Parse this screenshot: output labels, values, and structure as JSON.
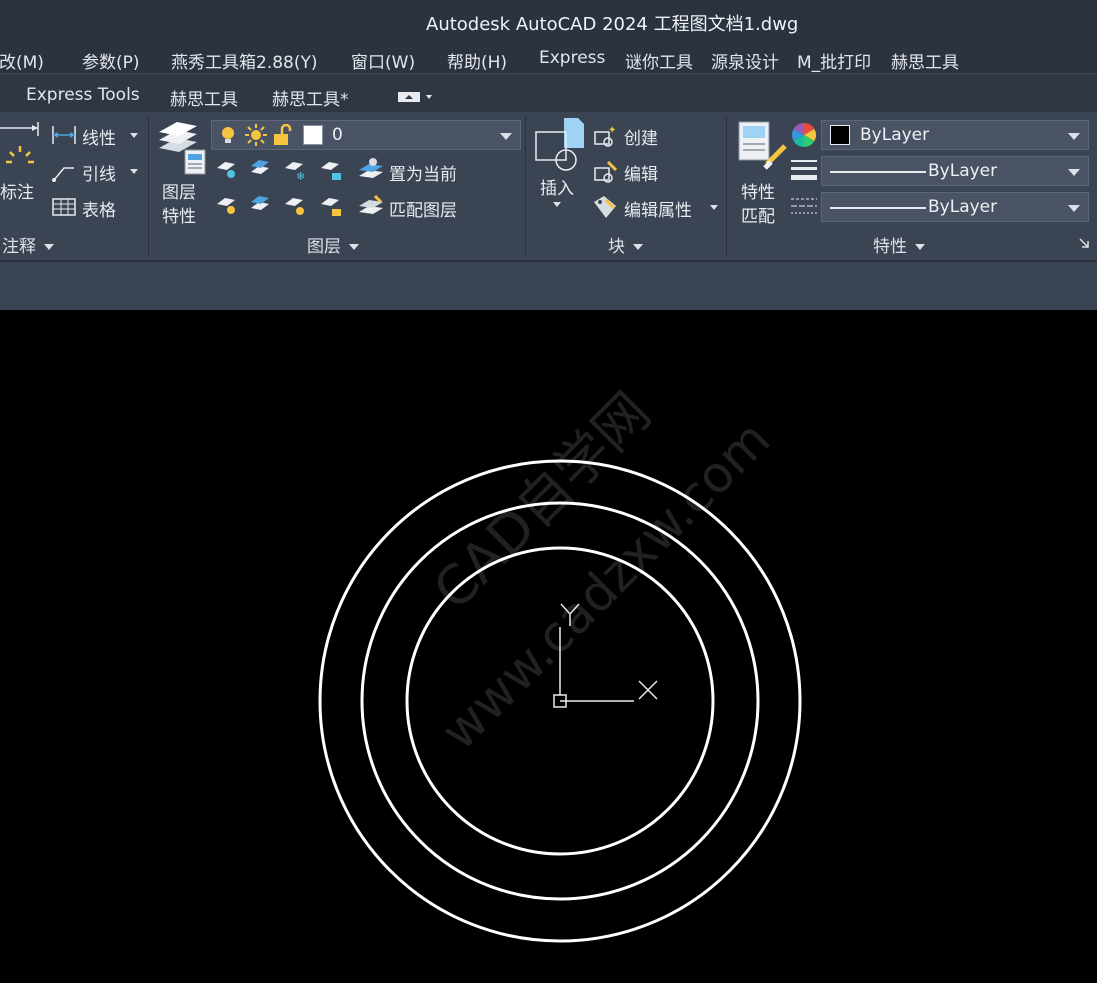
{
  "window": {
    "title": "Autodesk AutoCAD 2024    工程图文档1.dwg"
  },
  "menubar": {
    "items": [
      "修改(M)",
      "参数(P)",
      "燕秀工具箱2.88(Y)",
      "窗口(W)",
      "帮助(H)",
      "Express",
      "谜你工具",
      "源泉设计",
      "M_批打印",
      "赫思工具"
    ]
  },
  "tabs": {
    "items": [
      "Express Tools",
      "赫思工具",
      "赫思工具*"
    ]
  },
  "ribbon": {
    "annotation": {
      "title": "注释",
      "dimension_label": "标注",
      "linear_label": "线性",
      "leader_label": "引线",
      "table_label": "表格"
    },
    "layers": {
      "title": "图层",
      "properties_label_1": "图层",
      "properties_label_2": "特性",
      "current_layer": "0",
      "make_current_label": "置为当前",
      "match_layer_label": "匹配图层"
    },
    "block": {
      "title": "块",
      "insert_label": "插入",
      "create_label": "创建",
      "edit_label": "编辑",
      "edit_attributes_label": "编辑属性"
    },
    "properties": {
      "title": "特性",
      "match_label_1": "特性",
      "match_label_2": "匹配",
      "color_value": "ByLayer",
      "lineweight_value": "ByLayer",
      "linetype_value": "ByLayer"
    }
  },
  "canvas": {
    "watermark_1": "CAD自学网",
    "watermark_2": "www.cadzxw.com",
    "ucs": {
      "x_label": "X",
      "y_label": "Y"
    },
    "circles": [
      {
        "name": "outer",
        "radius": 240
      },
      {
        "name": "middle",
        "radius": 198
      },
      {
        "name": "inner",
        "radius": 153
      }
    ]
  },
  "colors": {
    "ribbon_bg": "#3b4453",
    "title_bg": "#2b3340",
    "canvas_bg": "#000000",
    "drawing_line": "#ffffff"
  }
}
